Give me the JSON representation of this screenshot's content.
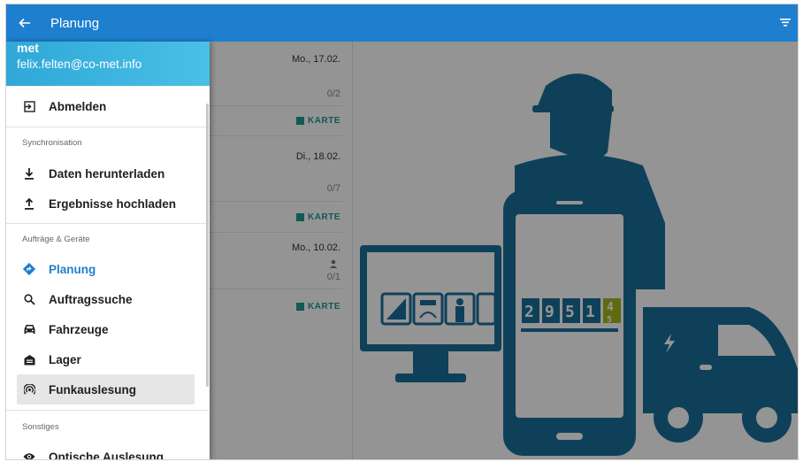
{
  "appbar": {
    "title": "Planung",
    "back_icon": "arrow-left-icon",
    "filter_icon": "filter-icon"
  },
  "list": {
    "days": [
      {
        "date": "Mo., 17.02.",
        "count": "0/2",
        "map_label": "KARTE"
      },
      {
        "date": "Di., 18.02.",
        "count": "0/7",
        "map_label": "KARTE"
      },
      {
        "date": "Mo., 10.02.",
        "count": "0/1",
        "map_label": "KARTE"
      }
    ]
  },
  "illustration": {
    "meter_digits": [
      "2",
      "9",
      "5",
      "1"
    ],
    "meter_last_top": "4",
    "meter_last_bottom": "5"
  },
  "drawer": {
    "user": "met",
    "email": "felix.felten@co-met.info",
    "logout": "Abmelden",
    "sections": {
      "sync": "Synchronisation",
      "orders": "Aufträge & Geräte",
      "other": "Sonstiges"
    },
    "items": {
      "download": "Daten herunterladen",
      "upload": "Ergebnisse hochladen",
      "planning": "Planung",
      "order_search": "Auftragssuche",
      "vehicles": "Fahrzeuge",
      "storage": "Lager",
      "radio": "Funkauslesung",
      "optical": "Optische Auslesung"
    }
  },
  "colors": {
    "primary": "#1f7fcf",
    "accent": "#1f9a8e",
    "illustration": "#1b6f9c",
    "header_gradient": "#2fa8d8"
  }
}
